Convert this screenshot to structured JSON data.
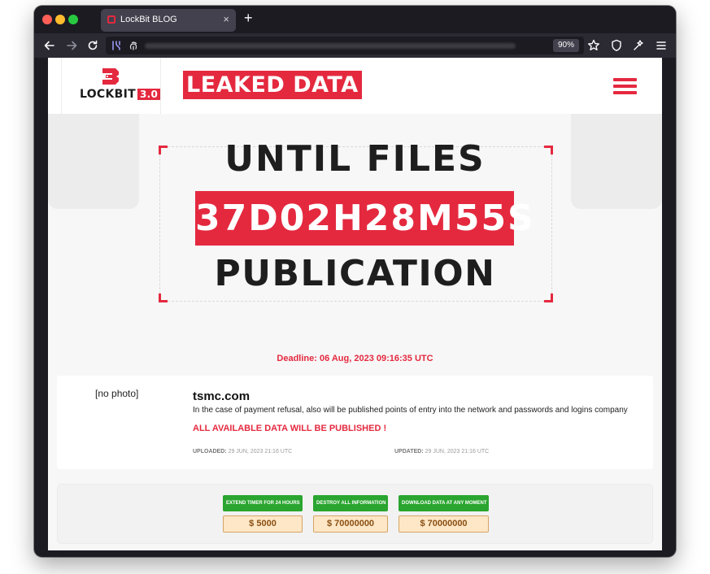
{
  "browser": {
    "tab_title": "LockBit BLOG",
    "tab_close": "×",
    "new_tab": "+",
    "zoom": "90%",
    "icons": [
      "back-icon",
      "forward-icon",
      "reload-icon",
      "extension-icon",
      "fingerprint-icon",
      "bookmark-star-icon",
      "shield-icon",
      "tools-icon",
      "menu-icon"
    ]
  },
  "header": {
    "logo_text": "LOCKBIT",
    "logo_version": "3.0",
    "leaked_label": "LEAKED DATA"
  },
  "countdown": {
    "top_line": "UNTIL FILES",
    "timer": "37D02H28M55S",
    "bottom_line": "PUBLICATION"
  },
  "deadline": "Deadline: 06 Aug, 2023 09:16:35 UTC",
  "post": {
    "photo_placeholder": "[no photo]",
    "domain": "tsmc.com",
    "description": "In the case of payment refusal, also will be published points of entry into the network and passwords and logins company",
    "warning": "ALL AVAILABLE DATA WILL BE PUBLISHED !",
    "uploaded_label": "UPLOADED:",
    "uploaded_value": "29 JUN, 2023 21:16 UTC",
    "updated_label": "UPDATED:",
    "updated_value": "29 JUN, 2023 21:16 UTC"
  },
  "actions": [
    {
      "label": "EXTEND TIMER FOR 24 HOURS",
      "price": "$ 5000"
    },
    {
      "label": "DESTROY ALL INFORMATION",
      "price": "$ 70000000"
    },
    {
      "label": "DOWNLOAD DATA AT ANY MOMENT",
      "price": "$ 70000000"
    }
  ],
  "colors": {
    "accent": "#e4293f",
    "button_green": "#2aa52f",
    "price_bg": "#fde7c6",
    "browser_chrome": "#1c1b22"
  }
}
